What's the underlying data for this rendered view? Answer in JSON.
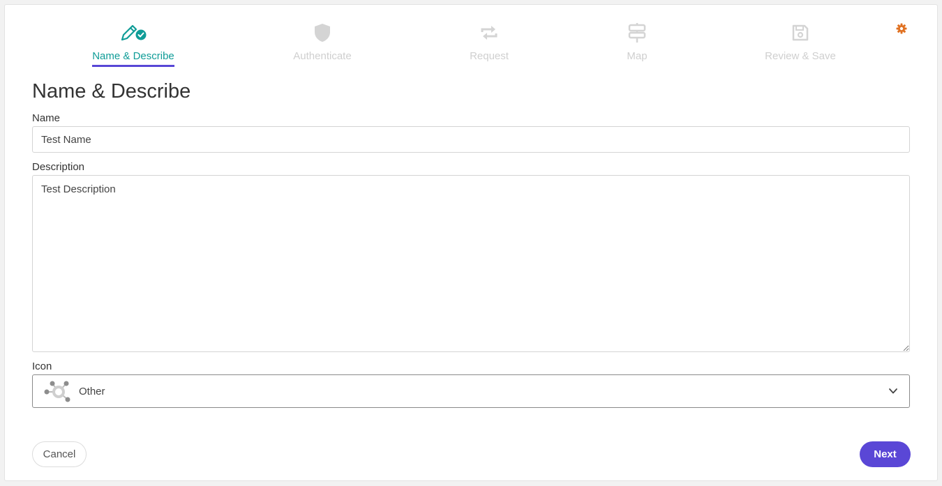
{
  "steps": [
    {
      "label": "Name & Describe",
      "icon": "pencil-check-icon",
      "active": true
    },
    {
      "label": "Authenticate",
      "icon": "shield-icon",
      "active": false
    },
    {
      "label": "Request",
      "icon": "exchange-arrows-icon",
      "active": false
    },
    {
      "label": "Map",
      "icon": "signpost-icon",
      "active": false
    },
    {
      "label": "Review & Save",
      "icon": "save-icon",
      "active": false
    }
  ],
  "settings_icon": "gear-icon",
  "page_title": "Name & Describe",
  "form": {
    "name_label": "Name",
    "name_value": "Test Name",
    "description_label": "Description",
    "description_value": "Test Description",
    "icon_label": "Icon",
    "icon_value": "Other",
    "icon_graphic": "network-nodes-icon"
  },
  "buttons": {
    "cancel": "Cancel",
    "next": "Next"
  },
  "colors": {
    "active_step": "#0f9c97",
    "active_underline": "#5847d6",
    "inactive_step": "#cfcfcf",
    "primary_button": "#5a47d6",
    "settings": "#e07020"
  }
}
